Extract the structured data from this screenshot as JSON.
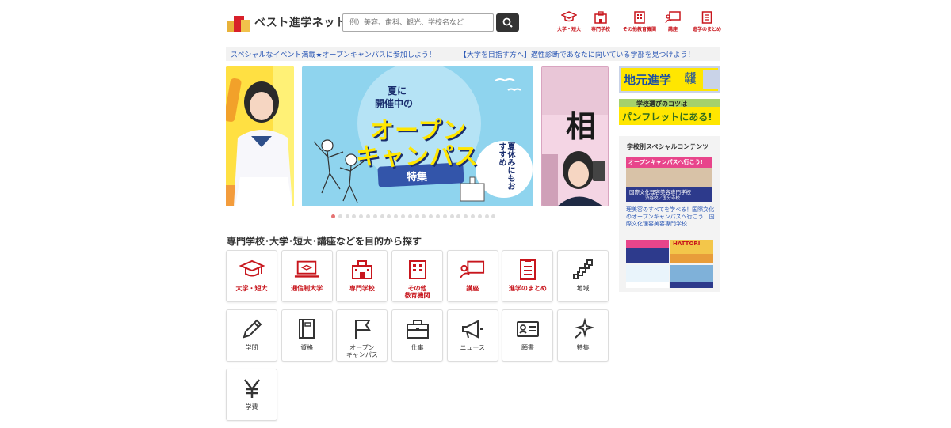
{
  "header": {
    "logo_text": "ベスト進学ネット",
    "search_placeholder": "例）美容、歯科、観光、学校名など",
    "nav": [
      {
        "label": "大学・短大",
        "icon": "mortarboard-icon"
      },
      {
        "label": "専門学校",
        "icon": "school-building-icon"
      },
      {
        "label": "その他教育機関",
        "icon": "office-building-icon"
      },
      {
        "label": "講座",
        "icon": "lecture-board-icon"
      },
      {
        "label": "進学のまとめ",
        "icon": "document-icon"
      }
    ]
  },
  "ticker": {
    "item1": "スペシャルなイベント満載★オープンキャンパスに参加しよう！",
    "item2": "【大学を目指す方へ】適性診断であなたに向いている学部を見つけよう！"
  },
  "carousel": {
    "main": {
      "line1": "夏に",
      "line2": "開催中の",
      "headline1": "オープン",
      "headline2": "キャンパス",
      "tag": "特集",
      "badge": "夏休みにもおすすめ"
    },
    "right_glyph": "相",
    "dot_count": 24,
    "active_dot": 0
  },
  "section": {
    "title": "専門学校･大学･短大･講座などを目的から探す",
    "categories": [
      {
        "label": "大学・短大",
        "icon": "mortarboard-icon",
        "style": "red"
      },
      {
        "label": "通信制大学",
        "icon": "laptop-icon",
        "style": "red"
      },
      {
        "label": "専門学校",
        "icon": "school-building-icon",
        "style": "red"
      },
      {
        "label": "その他\n教育機関",
        "icon": "office-building-icon",
        "style": "red"
      },
      {
        "label": "講座",
        "icon": "lecture-board-icon",
        "style": "red"
      },
      {
        "label": "進学のまとめ",
        "icon": "document-icon",
        "style": "red"
      },
      {
        "label": "地域",
        "icon": "japan-map-icon",
        "style": "dark"
      },
      {
        "label": "学問",
        "icon": "pencil-icon",
        "style": "dark"
      },
      {
        "label": "資格",
        "icon": "book-icon",
        "style": "dark"
      },
      {
        "label": "オープン\nキャンパス",
        "icon": "flag-icon",
        "style": "dark"
      },
      {
        "label": "仕事",
        "icon": "briefcase-icon",
        "style": "dark"
      },
      {
        "label": "ニュース",
        "icon": "megaphone-icon",
        "style": "dark"
      },
      {
        "label": "願書",
        "icon": "id-card-icon",
        "style": "dark"
      },
      {
        "label": "特集",
        "icon": "sparkle-icon",
        "style": "dark"
      },
      {
        "label": "学費",
        "icon": "yen-icon",
        "style": "dark"
      }
    ]
  },
  "sidebar": {
    "banner1_main": "地元進学",
    "banner1_sub": "応援特集",
    "banner2_top": "学校選びのコツは",
    "banner2_bottom": "パンフレットにある!",
    "box_title": "学校別スペシャルコンテンツ",
    "ad_headline": "オープンキャンパスへ行こう!",
    "ad_school": "国際文化理容美容専門学校",
    "ad_campus": "渋谷校／国分寺校",
    "ad_text": "理美容のすべてを学べる！国際文化のオープンキャンパスへ行こう！国際文化理容美容専門学校",
    "thumb2_text": "HATTORI"
  },
  "colors": {
    "brand_red": "#c8161d",
    "link_blue": "#2a57b5",
    "banner_yellow": "#ffe600"
  }
}
